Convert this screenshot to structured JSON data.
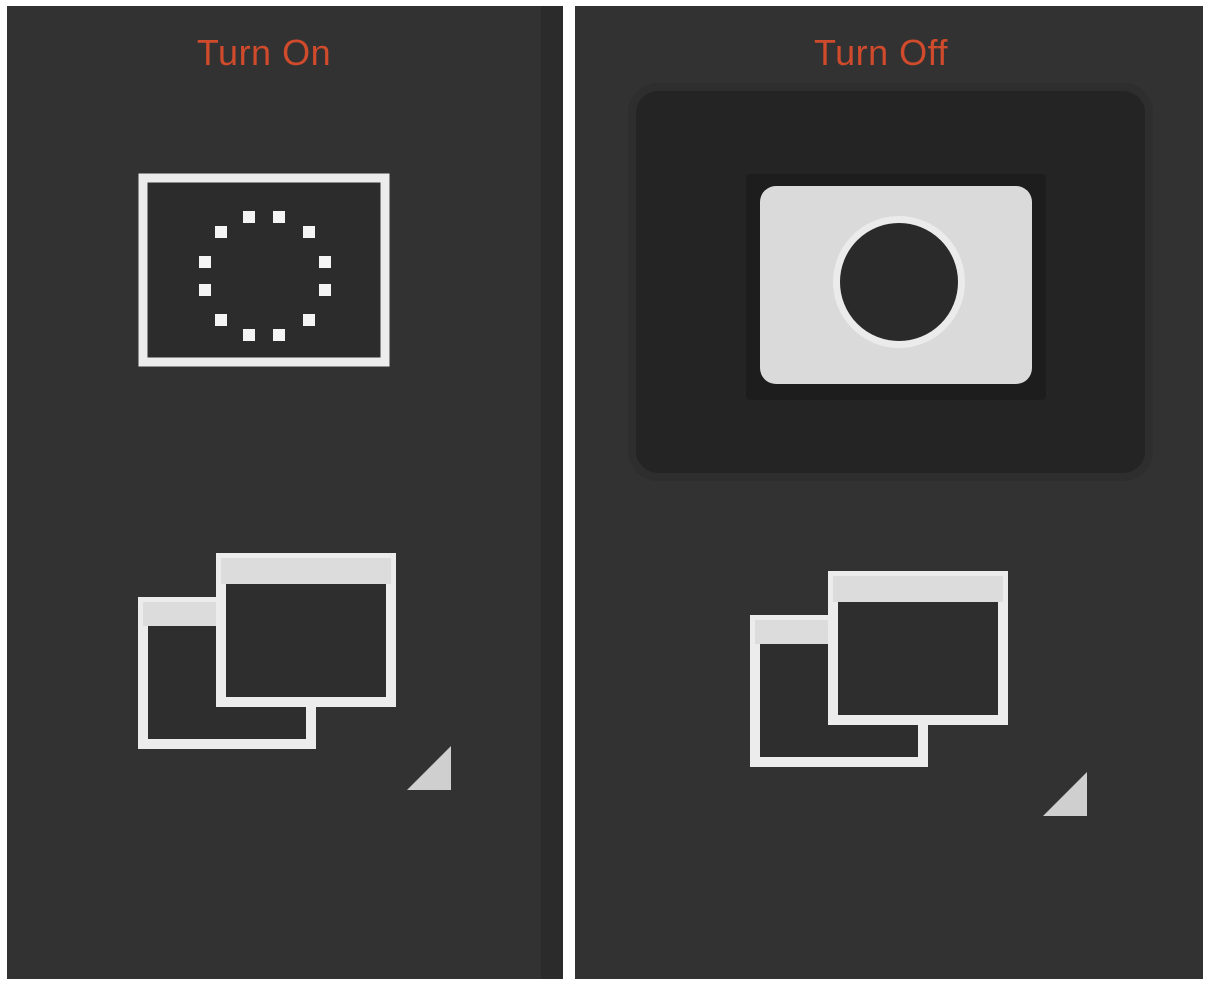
{
  "panels": [
    {
      "label": "Turn On",
      "record_button_icon": "record-dotted-circle-icon",
      "windows_icon": "multiple-windows-icon",
      "corner_icon": "dropdown-corner-triangle-icon"
    },
    {
      "label": "Turn Off",
      "record_button_icon": "record-stop-icon",
      "record_button_state": "active",
      "windows_icon": "multiple-windows-icon",
      "corner_icon": "dropdown-corner-triangle-icon"
    }
  ],
  "colors": {
    "label": "#d04a2c",
    "panel_background": "#323232",
    "icon_stroke": "#ececec",
    "active_highlight": "#242424"
  }
}
